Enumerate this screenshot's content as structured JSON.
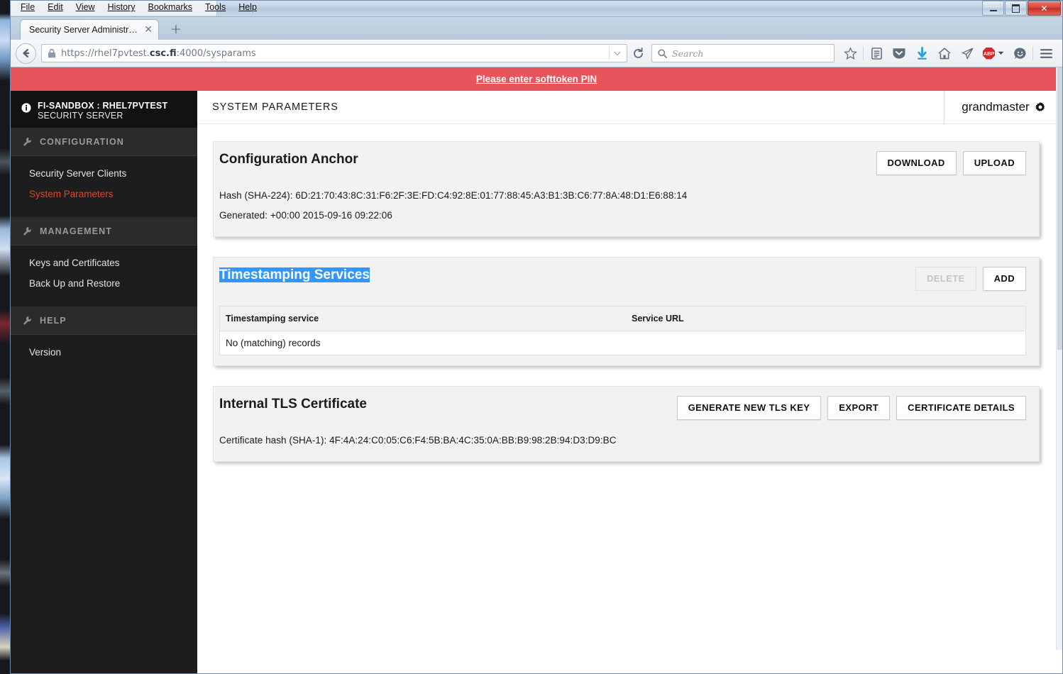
{
  "window": {
    "menus": [
      {
        "label": "File",
        "accel": "F"
      },
      {
        "label": "Edit",
        "accel": "E"
      },
      {
        "label": "View",
        "accel": "V"
      },
      {
        "label": "History",
        "accel": "s"
      },
      {
        "label": "Bookmarks",
        "accel": "B"
      },
      {
        "label": "Tools",
        "accel": "T"
      },
      {
        "label": "Help",
        "accel": "H"
      }
    ],
    "controls": {
      "minimize": "minimize-button",
      "maximize": "maximize-button",
      "close": "close-button",
      "close_glyph": "✕"
    }
  },
  "browser": {
    "tab": {
      "title": "Security Server Administration",
      "close_glyph": "✕"
    },
    "new_tab_glyph": "+",
    "url": {
      "scheme": "https://",
      "host_prefix": "rhel7pvtest.",
      "host_bold": "csc.fi",
      "rest": ":4000/sysparams",
      "full": "https://rhel7pvtest.csc.fi:4000/sysparams"
    },
    "search": {
      "placeholder": "Search"
    },
    "toolbar_icons": [
      "star-icon",
      "reader-list-icon",
      "pocket-shield-icon",
      "download-arrow-icon",
      "home-icon",
      "paper-plane-icon",
      "adblock-plus-icon",
      "feedback-smiley-icon",
      "hamburger-menu-icon"
    ],
    "adblock_label": "ABP"
  },
  "alert": {
    "message": "Please enter softtoken PIN"
  },
  "sidebar": {
    "server_name": "FI-SANDBOX : RHEL7PVTEST",
    "server_role": "SECURITY SERVER",
    "sections": [
      {
        "label": "CONFIGURATION",
        "items": [
          {
            "label": "Security Server Clients",
            "active": false
          },
          {
            "label": "System Parameters",
            "active": true
          }
        ]
      },
      {
        "label": "MANAGEMENT",
        "items": [
          {
            "label": "Keys and Certificates",
            "active": false
          },
          {
            "label": "Back Up and Restore",
            "active": false
          }
        ]
      },
      {
        "label": "HELP",
        "items": [
          {
            "label": "Version",
            "active": false
          }
        ]
      }
    ]
  },
  "header": {
    "title": "SYSTEM PARAMETERS",
    "user": "grandmaster"
  },
  "panels": {
    "configuration_anchor": {
      "title": "Configuration Anchor",
      "download_label": "DOWNLOAD",
      "upload_label": "UPLOAD",
      "hash_line": "Hash (SHA-224): 6D:21:70:43:8C:31:F6:2F:3E:FD:C4:92:8E:01:77:88:45:A3:B1:3B:C6:77:8A:48:D1:E6:88:14",
      "generated_line": "Generated: +00:00 2015-09-16 09:22:06"
    },
    "timestamping_services": {
      "title": "Timestamping Services",
      "delete_label": "DELETE",
      "delete_disabled": true,
      "add_label": "ADD",
      "columns": [
        "Timestamping service",
        "Service URL"
      ],
      "empty_message": "No (matching) records"
    },
    "internal_tls_certificate": {
      "title": "Internal TLS Certificate",
      "generate_label": "GENERATE NEW TLS KEY",
      "export_label": "EXPORT",
      "details_label": "CERTIFICATE DETAILS",
      "hash_line": "Certificate hash (SHA-1): 4F:4A:24:C0:05:C6:F4:5B:BA:4C:35:0A:BB:B9:98:2B:94:D3:D9:BC"
    }
  },
  "colors": {
    "alert_red": "#e8545b",
    "active_nav": "#e8412c",
    "selection_blue": "#3297fd",
    "sidebar_bg": "#1d1d1d",
    "panel_bg": "#f2f2f2"
  }
}
